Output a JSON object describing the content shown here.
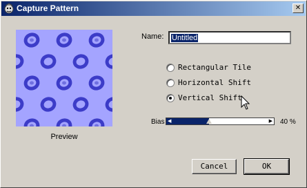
{
  "window": {
    "title": "Capture Pattern",
    "close_glyph": "✕",
    "icon": "app-icon"
  },
  "preview": {
    "label": "Preview",
    "background_color": "#a4a4ff",
    "motif_color": "#3c3cc8"
  },
  "name": {
    "label": "Name:",
    "value": "Untitled"
  },
  "options": [
    {
      "label": "Rectangular Tile",
      "selected": false
    },
    {
      "label": "Horizontal Shift",
      "selected": false
    },
    {
      "label": "Vertical Shift",
      "selected": true
    }
  ],
  "bias": {
    "label": "Bias",
    "value_text": "40 %",
    "value_fraction": 0.4
  },
  "buttons": {
    "cancel": "Cancel",
    "ok": "OK"
  },
  "colors": {
    "dialog_bg": "#d4d0c8",
    "titlebar_start": "#0a246a",
    "titlebar_end": "#a6caf0",
    "selection": "#0a246a"
  }
}
